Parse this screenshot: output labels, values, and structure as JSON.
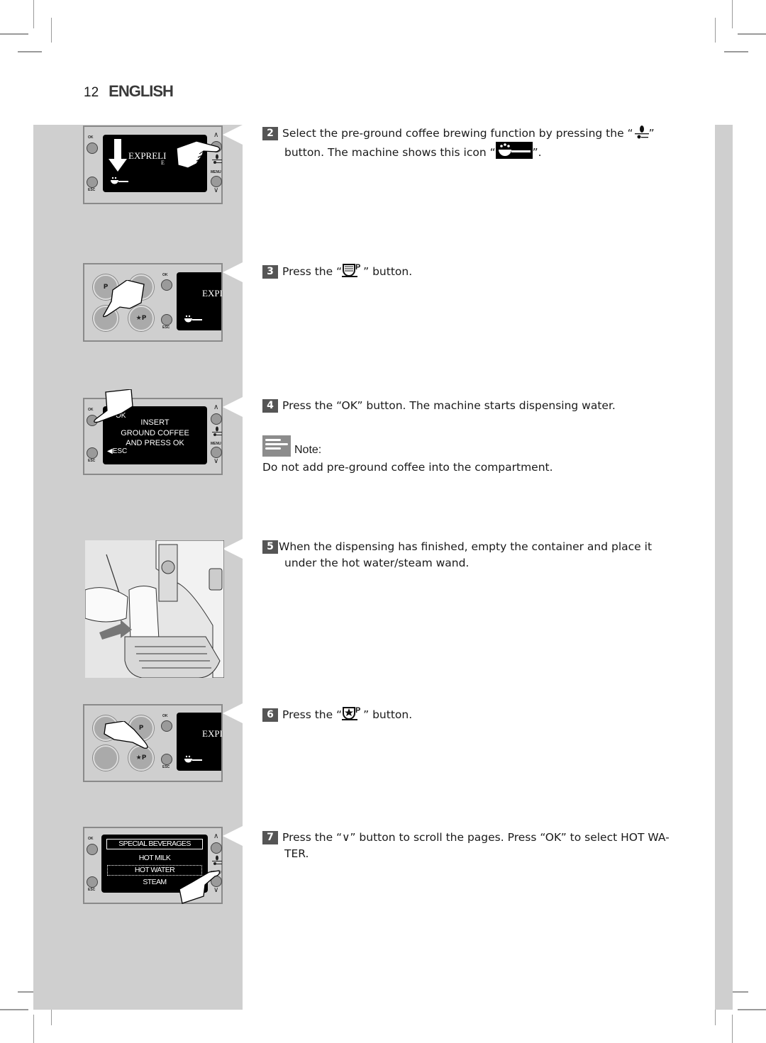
{
  "header": {
    "page_number": "12",
    "language": "ENGLISH"
  },
  "panels": {
    "p1": {
      "labels": {
        "ok": "OK",
        "esc": "ESC",
        "menu": "MENU",
        "up": "∧",
        "down": "∨"
      },
      "logo": "EXPRELI",
      "logo_sub": "E"
    },
    "p2": {
      "labels": {
        "ok": "OK",
        "esc": "ESC"
      },
      "logo": "EXPI",
      "cup_buttons": [
        "P",
        "",
        "",
        "★P"
      ]
    },
    "p3": {
      "labels": {
        "ok": "OK",
        "esc": "ESC",
        "menu": "MENU",
        "up": "∧",
        "down": "∨"
      },
      "screen_ok": "OK",
      "screen_lines": [
        "INSERT",
        "GROUND COFFEE",
        "AND PRESS OK"
      ],
      "screen_esc": "ESC"
    },
    "p5": {
      "labels": {
        "ok": "OK",
        "esc": "ESC"
      },
      "logo": "EXPI",
      "cup_buttons": [
        "",
        "P",
        "",
        "★P"
      ]
    },
    "p6": {
      "labels": {
        "ok": "OK",
        "esc": "ESC",
        "menu": "MENU",
        "up": "∧",
        "down": "∨"
      },
      "menu_title": "SPECIAL BEVERAGES",
      "menu_items": [
        "HOT MILK",
        "HOT WATER",
        "STEAM"
      ],
      "selected_item": "HOT WATER"
    }
  },
  "steps": [
    {
      "num": "2",
      "text_a": "Select the pre-ground coffee brewing function by pressing the “",
      "text_b": "”",
      "text_c": "button. The machine shows this icon “",
      "text_d": "”."
    },
    {
      "num": "3",
      "text_a": "Press the “",
      "text_b": "” button."
    },
    {
      "num": "4",
      "text": "Press the “OK” button. The machine starts dispensing water."
    },
    {
      "num": "5",
      "line1": "When the dispensing has finished, empty the container and place it",
      "line2": "under the hot water/steam wand."
    },
    {
      "num": "6",
      "text_a": "Press the “",
      "text_b": "” button."
    },
    {
      "num": "7",
      "line1": "Press the “∨” button to scroll the pages. Press “OK” to select HOT WA-",
      "line2": "TER."
    }
  ],
  "note": {
    "label": "Note:",
    "text": "Do not add pre-ground coffee into the compartment."
  },
  "colors": {
    "sidebar_gray": "#cfcfcf",
    "badge_gray": "#555555",
    "screen_black": "#000000"
  }
}
